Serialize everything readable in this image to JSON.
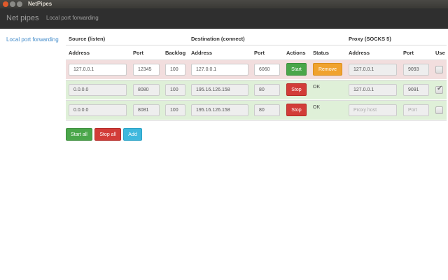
{
  "window": {
    "title": "NetPipes"
  },
  "navbar": {
    "brand": "Net pipes",
    "link": "Local port forwarding"
  },
  "sidebar": {
    "item": "Local port forwarding"
  },
  "sections": {
    "source": "Source (listen)",
    "destination": "Destination (connect)",
    "proxy": "Proxy (SOCKS 5)"
  },
  "columns": {
    "src_address": "Address",
    "src_port": "Port",
    "backlog": "Backlog",
    "dst_address": "Address",
    "dst_port": "Port",
    "actions": "Actions",
    "status": "Status",
    "proxy_address": "Address",
    "proxy_port": "Port",
    "use": "Use"
  },
  "rows": [
    {
      "src_address": "127.0.0.1",
      "src_port": "12345",
      "backlog": "100",
      "dst_address": "127.0.0.1",
      "dst_port": "6060",
      "action": "Start",
      "status_button": "Remove",
      "proxy_address": "127.0.0.1",
      "proxy_port": "9093",
      "use_proxy": false
    },
    {
      "src_address": "0.0.0.0",
      "src_port": "8080",
      "backlog": "100",
      "dst_address": "195.16.126.158",
      "dst_port": "80",
      "action": "Stop",
      "status": "OK",
      "proxy_address": "127.0.0.1",
      "proxy_port": "9091",
      "use_proxy": true
    },
    {
      "src_address": "0.0.0.0",
      "src_port": "8081",
      "backlog": "100",
      "dst_address": "195.16.126.158",
      "dst_port": "80",
      "action": "Stop",
      "status": "OK",
      "proxy_address_placeholder": "Proxy host",
      "proxy_port_placeholder": "Port",
      "use_proxy": false
    }
  ],
  "buttons": {
    "start_all": "Start all",
    "stop_all": "Stop all",
    "add": "Add"
  },
  "colors": {
    "success_row": "#dff0d8",
    "danger_row": "#f2dede",
    "start": "#4aa64a",
    "stop": "#d23c38",
    "remove": "#f0a22e",
    "add": "#3fb8dd",
    "link": "#428bca"
  }
}
